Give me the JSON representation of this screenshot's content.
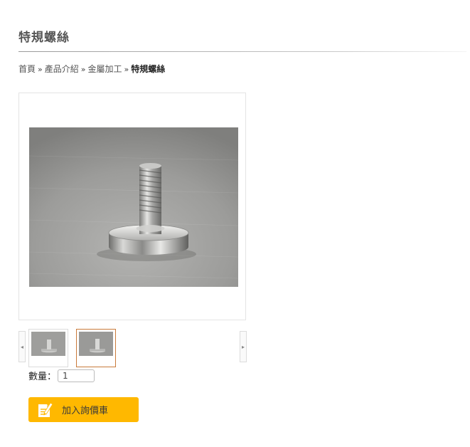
{
  "page": {
    "title": "特規螺絲"
  },
  "breadcrumb": {
    "items": [
      "首頁",
      "產品介紹",
      "金屬加工"
    ],
    "separator": "»",
    "current": "特規螺絲"
  },
  "gallery": {
    "prev_icon": "chevron-left-icon",
    "next_icon": "chevron-right-icon",
    "prev_glyph": "◂",
    "next_glyph": "▸",
    "thumb_count": 2,
    "active_thumb": 2
  },
  "quantity": {
    "label": "數量：",
    "value": "1"
  },
  "actions": {
    "add_inquiry_label": "加入詢價車",
    "add_inquiry_icon": "inquiry-note-icon"
  },
  "colors": {
    "button_bg": "#ffb800",
    "active_thumb_border": "#c97a3a",
    "title_rule": "#9a9a9a"
  }
}
